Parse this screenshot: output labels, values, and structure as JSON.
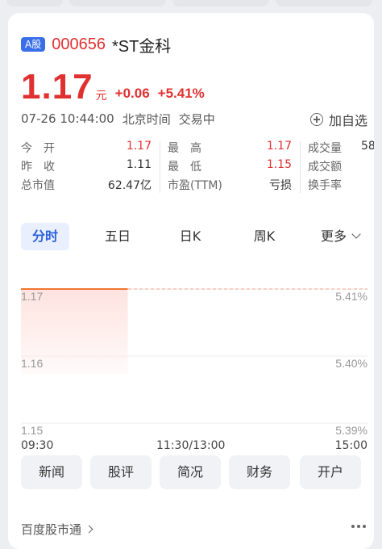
{
  "header": {
    "badge": "A股",
    "code": "000656",
    "name": "*ST金科"
  },
  "quote": {
    "price": "1.17",
    "unit": "元",
    "change": "+0.06",
    "change_pct": "+5.41%",
    "datetime": "07-26 10:44:00",
    "timezone": "北京时间",
    "status": "交易中",
    "add_watch": "加自选"
  },
  "stats": {
    "open_label": "今　开",
    "open_value": "1.17",
    "prev_close_label": "昨　收",
    "prev_close_value": "1.11",
    "mkt_cap_label": "总市值",
    "mkt_cap_value": "62.47亿",
    "high_label": "最　高",
    "high_value": "1.17",
    "low_label": "最　低",
    "low_value": "1.15",
    "pe_label": "市盈(TTM)",
    "pe_value": "亏损",
    "volume_label": "成交量",
    "volume_value": "58",
    "amount_label": "成交额",
    "turnover_label": "换手率"
  },
  "tabs": [
    {
      "label": "分时",
      "active": true
    },
    {
      "label": "五日"
    },
    {
      "label": "日K"
    },
    {
      "label": "周K"
    },
    {
      "label": "更多"
    }
  ],
  "chart_data": {
    "type": "area",
    "x_ticks": [
      "09:30",
      "11:30/13:00",
      "15:00"
    ],
    "y_ticks_price": [
      "1.17",
      "1.16",
      "1.15"
    ],
    "y_ticks_pct": [
      "5.41%",
      "5.40%",
      "5.39%"
    ],
    "ylim": [
      1.15,
      1.17
    ],
    "series": [
      {
        "x": [
          "09:30",
          "10:44"
        ],
        "y": [
          1.17,
          1.17
        ]
      }
    ],
    "reference_line": 1.17,
    "colors": {
      "line": "#f07430",
      "fill": "#fde3df",
      "grid": "#eeeeee"
    }
  },
  "actions": [
    "新闻",
    "股评",
    "简况",
    "财务",
    "开户"
  ],
  "footer": {
    "link": "百度股市通"
  },
  "colors": {
    "up": "#e03131",
    "accent": "#2d62db",
    "badge": "#3b6fe8"
  }
}
